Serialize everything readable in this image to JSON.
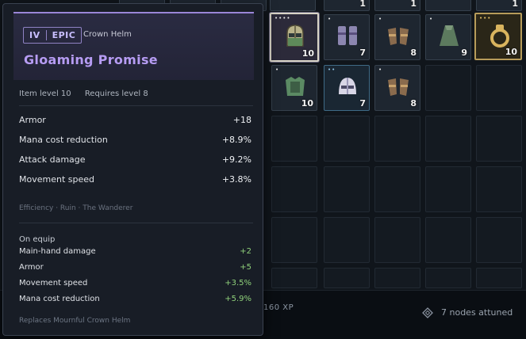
{
  "tooltip": {
    "tier": "IV",
    "rarity": "EPIC",
    "item_type": "Crown Helm",
    "name": "Gloaming Promise",
    "item_level": "Item level 10",
    "requires_level": "Requires level 8",
    "primary_stats": [
      {
        "label": "Armor",
        "value": "+18"
      },
      {
        "label": "Mana cost reduction",
        "value": "+8.9%"
      },
      {
        "label": "Attack damage",
        "value": "+9.2%"
      },
      {
        "label": "Movement speed",
        "value": "+3.8%"
      }
    ],
    "tags": "Efficiency · Ruin · The Wanderer",
    "on_equip_title": "On equip",
    "on_equip_stats": [
      {
        "label": "Main-hand damage",
        "value": "+2"
      },
      {
        "label": "Armor",
        "value": "+5"
      },
      {
        "label": "Movement speed",
        "value": "+3.5%"
      },
      {
        "label": "Mana cost reduction",
        "value": "+5.9%"
      }
    ],
    "replaces": "Replaces Mournful Crown Helm",
    "accent_color": "#b69cf3"
  },
  "inventory": {
    "top_partial_counts": [
      "1",
      "1",
      "1"
    ],
    "row1": [
      {
        "icon": "crown-helm-icon",
        "count": "10",
        "pips": "••••",
        "state": "selected"
      },
      {
        "icon": "greaves-icon",
        "count": "7",
        "pips": "•",
        "state": "filled"
      },
      {
        "icon": "gauntlets-icon",
        "count": "8",
        "pips": "•",
        "state": "filled"
      },
      {
        "icon": "cloak-icon",
        "count": "9",
        "pips": "•",
        "state": "filled"
      },
      {
        "icon": "ring-icon",
        "count": "10",
        "pips": "•••",
        "state": "legendary"
      }
    ],
    "row2": [
      {
        "icon": "chest-armor-icon",
        "count": "10",
        "pips": "•",
        "state": "filled"
      },
      {
        "icon": "helmet-icon",
        "count": "7",
        "pips": "••",
        "state": "rare"
      },
      {
        "icon": "gauntlets-icon",
        "count": "8",
        "pips": "•",
        "state": "filled"
      }
    ]
  },
  "footer": {
    "xp": "160 XP",
    "attuned": "7 nodes attuned"
  }
}
